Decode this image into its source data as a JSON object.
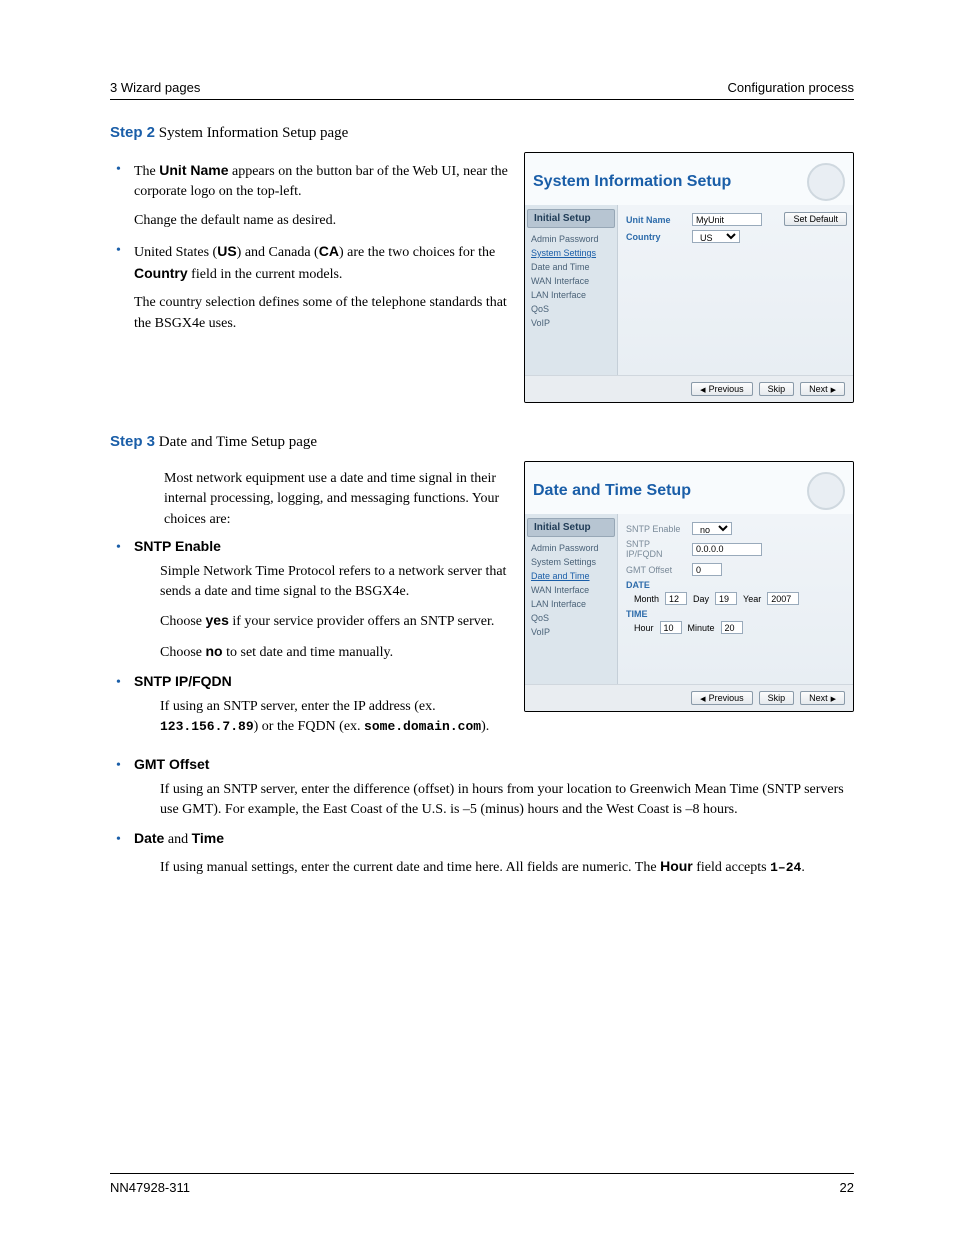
{
  "header": {
    "left": "3 Wizard pages",
    "right": "Configuration process"
  },
  "step2": {
    "label": "Step 2",
    "title": "System Information Setup page",
    "b1a": "The ",
    "b1b": "Unit Name",
    "b1c": " appears on the button bar of the Web UI, near the corporate logo on the top-left.",
    "b1d": "Change the default name as desired.",
    "b2a": "United States (",
    "b2b": "US",
    "b2c": ") and Canada (",
    "b2d": "CA",
    "b2e": ") are the two choices for the ",
    "b2f": "Country",
    "b2g": " field in the current models.",
    "b2h": "The country selection defines some of the telephone standards that the BSGX4e uses."
  },
  "step3": {
    "label": "Step 3",
    "title": "Date and Time Setup page",
    "intro": "Most network equipment use a date and time signal in their internal processing, logging, and messaging functions. Your choices are:",
    "sntp_enable": "SNTP Enable",
    "sntp_desc": "Simple Network Time Protocol refers to a network server that sends a date and time signal to the BSGX4e.",
    "sntp_yes_a": "Choose ",
    "sntp_yes_b": "yes",
    "sntp_yes_c": " if your service provider offers an SNTP server.",
    "sntp_no_a": "Choose ",
    "sntp_no_b": "no",
    "sntp_no_c": " to set date and time manually.",
    "fqdn_head": "SNTP IP/FQDN",
    "fqdn_a": "If using an SNTP server, enter the IP address (ex. ",
    "fqdn_ip": "123.156.7.89",
    "fqdn_b": ") or the FQDN (ex. ",
    "fqdn_dom": "some.domain.com",
    "fqdn_c": ").",
    "gmt_head": "GMT Offset",
    "gmt_body": "If using an SNTP server, enter the difference (offset) in hours from your location to Greenwich Mean Time (SNTP servers use GMT). For example, the East Coast of the U.S. is –5 (minus) hours and the West Coast is –8 hours.",
    "dt_head_a": "Date",
    "dt_head_and": " and ",
    "dt_head_b": "Time",
    "dt_body_a": "If using manual settings, enter the current date and time here. All fields are numeric. The ",
    "dt_body_b": "Hour",
    "dt_body_c": " field accepts ",
    "dt_body_d": "1–24",
    "dt_body_e": "."
  },
  "panel_common": {
    "sidebar_header": "Initial Setup",
    "items": [
      "Admin Password",
      "System Settings",
      "Date and Time",
      "WAN Interface",
      "LAN Interface",
      "QoS",
      "VoIP"
    ],
    "btn_prev": "Previous",
    "btn_skip": "Skip",
    "btn_next": "Next",
    "btn_set_default": "Set Default"
  },
  "panel_sys": {
    "title": "System Information Setup",
    "unit_name_lbl": "Unit Name",
    "unit_name_val": "MyUnit",
    "country_lbl": "Country",
    "country_val": "US"
  },
  "panel_dt": {
    "title": "Date and Time Setup",
    "sntp_enable_lbl": "SNTP Enable",
    "sntp_enable_val": "no",
    "sntp_ip_lbl": "SNTP IP/FQDN",
    "sntp_ip_val": "0.0.0.0",
    "gmt_lbl": "GMT Offset",
    "gmt_val": "0",
    "date_section": "DATE",
    "month_lbl": "Month",
    "month_val": "12",
    "day_lbl": "Day",
    "day_val": "19",
    "year_lbl": "Year",
    "year_val": "2007",
    "time_section": "TIME",
    "hour_lbl": "Hour",
    "hour_val": "10",
    "minute_lbl": "Minute",
    "minute_val": "20"
  },
  "footer": {
    "left": "NN47928-311",
    "right": "22"
  }
}
